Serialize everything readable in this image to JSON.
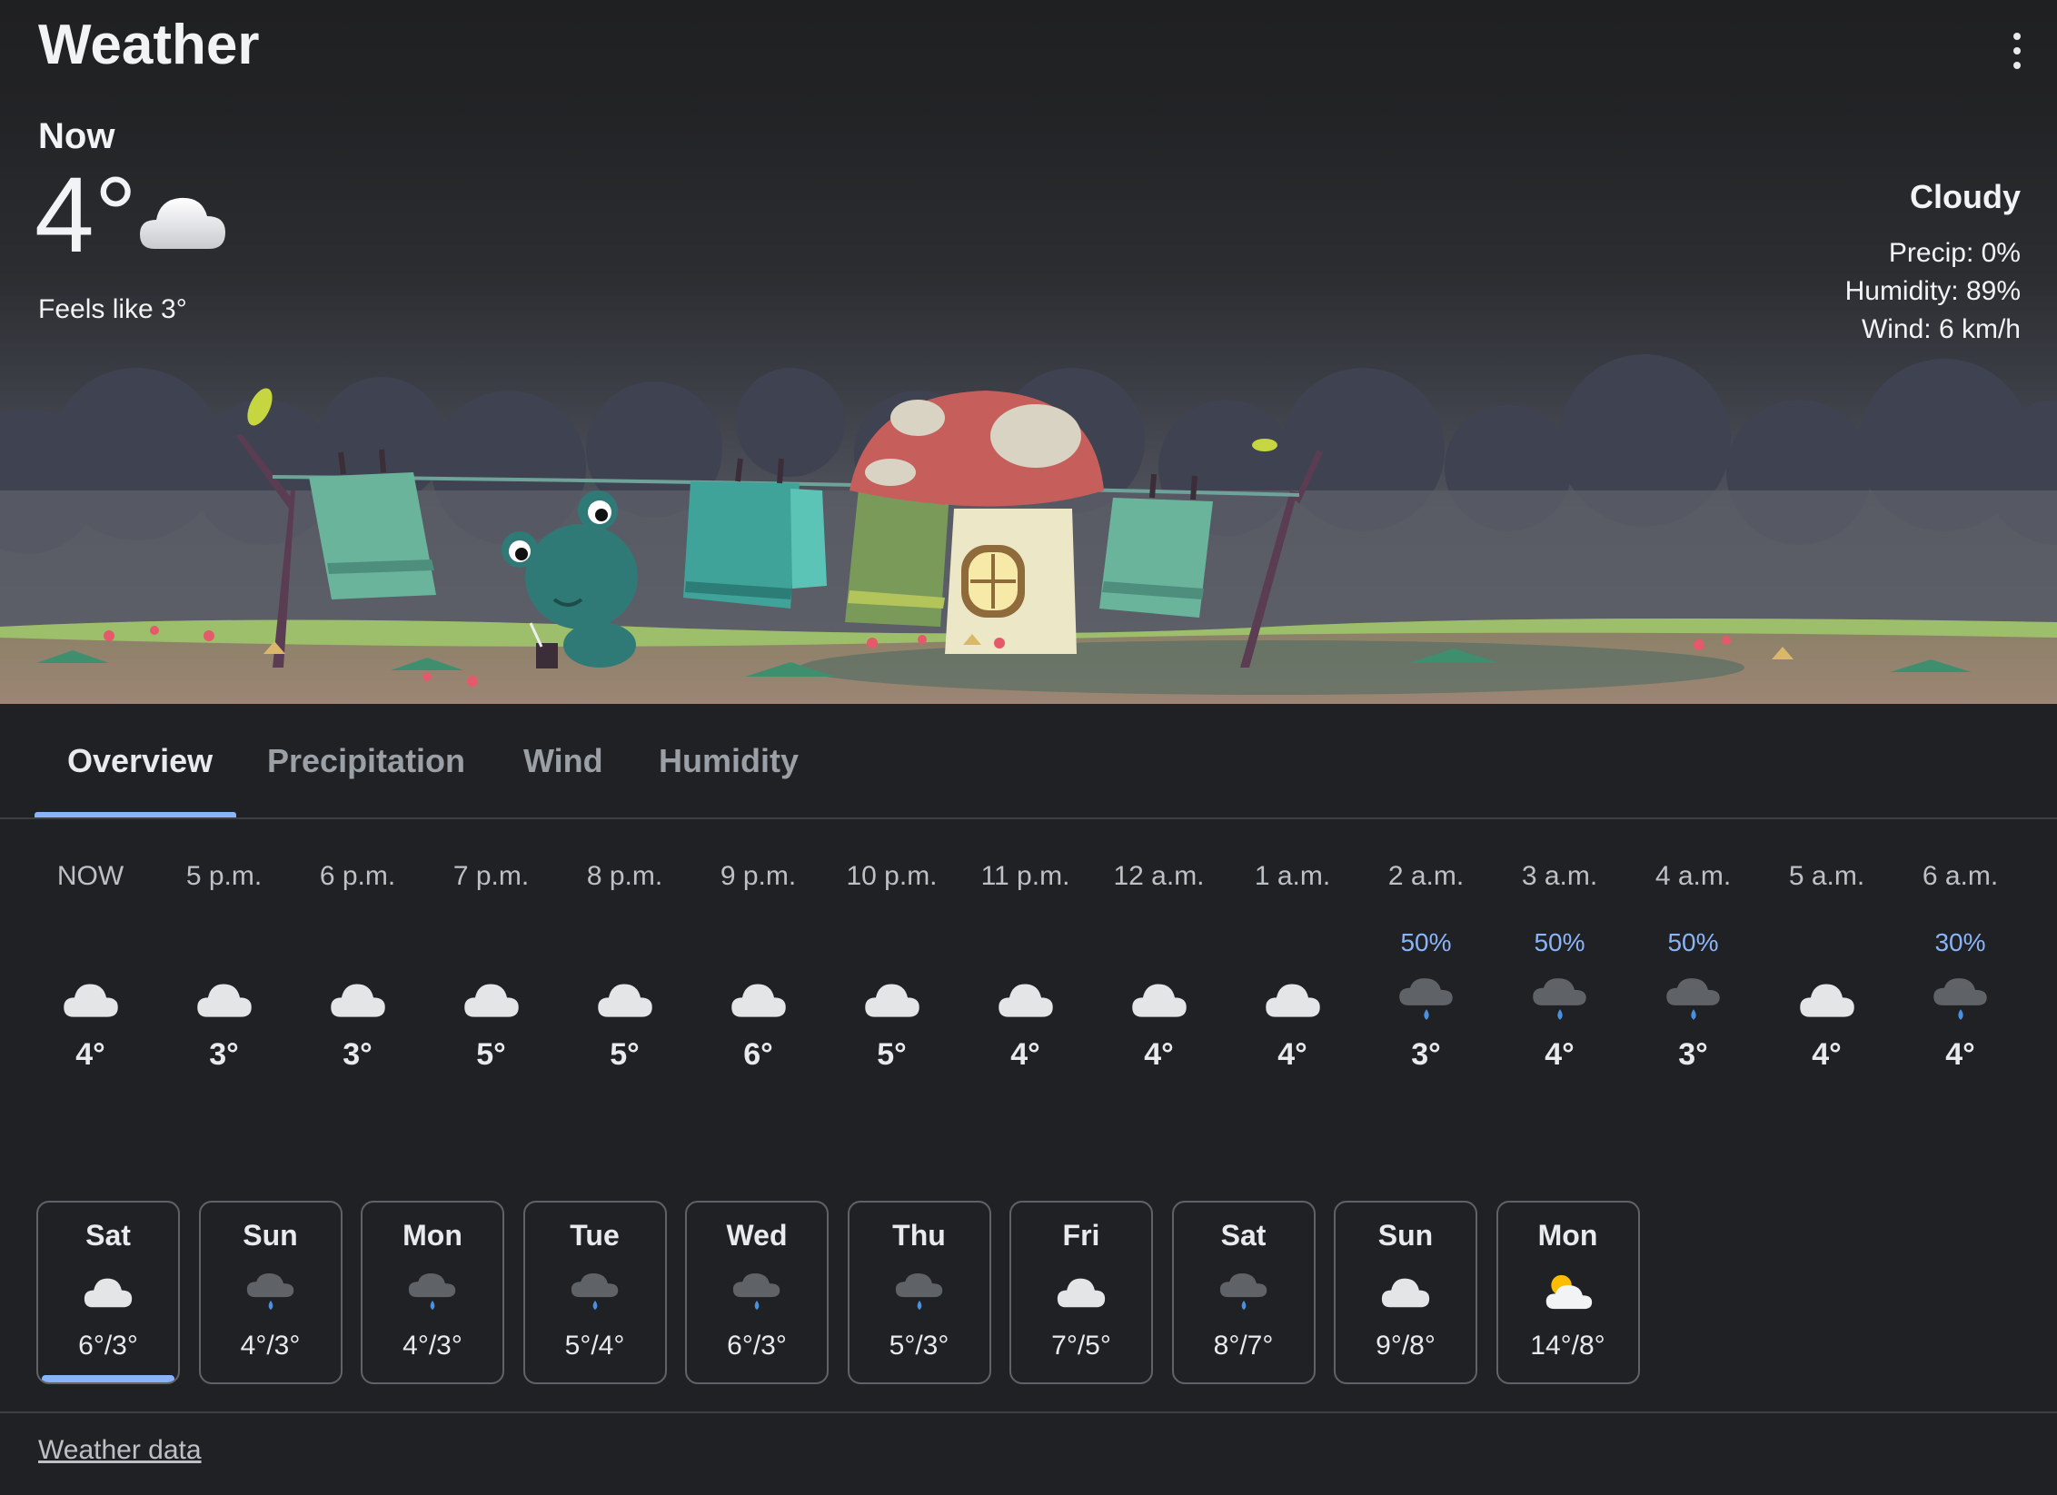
{
  "app": {
    "title": "Weather"
  },
  "current": {
    "label": "Now",
    "temp": "4°",
    "icon": "cloud-icon",
    "feels_like": "Feels like 3°",
    "condition": "Cloudy",
    "precip": "Precip: 0%",
    "humidity": "Humidity: 89%",
    "wind": "Wind: 6 km/h"
  },
  "tabs": [
    {
      "label": "Overview",
      "active": true
    },
    {
      "label": "Precipitation",
      "active": false
    },
    {
      "label": "Wind",
      "active": false
    },
    {
      "label": "Humidity",
      "active": false
    }
  ],
  "hourly": [
    {
      "time": "NOW",
      "precip": "",
      "icon": "cloud-icon",
      "temp": "4°"
    },
    {
      "time": "5 p.m.",
      "precip": "",
      "icon": "cloud-icon",
      "temp": "3°"
    },
    {
      "time": "6 p.m.",
      "precip": "",
      "icon": "cloud-icon",
      "temp": "3°"
    },
    {
      "time": "7 p.m.",
      "precip": "",
      "icon": "cloud-icon",
      "temp": "5°"
    },
    {
      "time": "8 p.m.",
      "precip": "",
      "icon": "cloud-icon",
      "temp": "5°"
    },
    {
      "time": "9 p.m.",
      "precip": "",
      "icon": "cloud-icon",
      "temp": "6°"
    },
    {
      "time": "10 p.m.",
      "precip": "",
      "icon": "cloud-icon",
      "temp": "5°"
    },
    {
      "time": "11 p.m.",
      "precip": "",
      "icon": "cloud-icon",
      "temp": "4°"
    },
    {
      "time": "12 a.m.",
      "precip": "",
      "icon": "cloud-icon",
      "temp": "4°"
    },
    {
      "time": "1 a.m.",
      "precip": "",
      "icon": "cloud-icon",
      "temp": "4°"
    },
    {
      "time": "2 a.m.",
      "precip": "50%",
      "icon": "rain-cloud-icon",
      "temp": "3°"
    },
    {
      "time": "3 a.m.",
      "precip": "50%",
      "icon": "rain-cloud-icon",
      "temp": "4°"
    },
    {
      "time": "4 a.m.",
      "precip": "50%",
      "icon": "rain-cloud-icon",
      "temp": "3°"
    },
    {
      "time": "5 a.m.",
      "precip": "",
      "icon": "cloud-icon",
      "temp": "4°"
    },
    {
      "time": "6 a.m.",
      "precip": "30%",
      "icon": "rain-cloud-icon",
      "temp": "4°"
    }
  ],
  "daily": [
    {
      "day": "Sat",
      "icon": "cloud-icon",
      "temps": "6°/3°",
      "selected": true
    },
    {
      "day": "Sun",
      "icon": "rain-cloud-icon",
      "temps": "4°/3°",
      "selected": false
    },
    {
      "day": "Mon",
      "icon": "rain-cloud-icon",
      "temps": "4°/3°",
      "selected": false
    },
    {
      "day": "Tue",
      "icon": "rain-cloud-icon",
      "temps": "5°/4°",
      "selected": false
    },
    {
      "day": "Wed",
      "icon": "rain-cloud-icon",
      "temps": "6°/3°",
      "selected": false
    },
    {
      "day": "Thu",
      "icon": "rain-cloud-icon",
      "temps": "5°/3°",
      "selected": false
    },
    {
      "day": "Fri",
      "icon": "cloud-icon",
      "temps": "7°/5°",
      "selected": false
    },
    {
      "day": "Sat",
      "icon": "rain-cloud-icon",
      "temps": "8°/7°",
      "selected": false
    },
    {
      "day": "Sun",
      "icon": "cloud-icon",
      "temps": "9°/8°",
      "selected": false
    },
    {
      "day": "Mon",
      "icon": "partly-sunny-icon",
      "temps": "14°/8°",
      "selected": false
    }
  ],
  "footer": {
    "link": "Weather data"
  },
  "colors": {
    "accent": "#8ab4f8",
    "background": "#202124",
    "precip": "#8ab4f8"
  }
}
